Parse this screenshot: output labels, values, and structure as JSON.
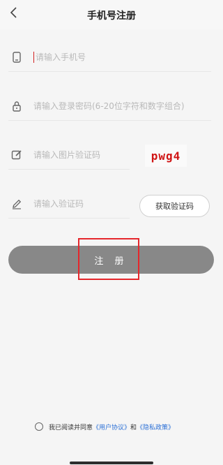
{
  "header": {
    "title": "手机号注册",
    "back_icon": "chevron-left-icon"
  },
  "form": {
    "phone": {
      "placeholder": "请输入手机号",
      "icon": "phone-icon",
      "value": ""
    },
    "password": {
      "placeholder": "请输入登录密码(6-20位字符和数字组合)",
      "icon": "lock-icon",
      "value": ""
    },
    "captcha": {
      "placeholder": "请输入图片验证码",
      "icon": "edit-icon",
      "value": "",
      "image_text": "pwg4"
    },
    "sms": {
      "placeholder": "请输入验证码",
      "icon": "pencil-icon",
      "value": "",
      "button_label": "获取验证码"
    }
  },
  "register_button": {
    "label": "注 册"
  },
  "agreement": {
    "prefix": "我已阅读并同意",
    "user_agreement": "《用户协议》",
    "and": "和",
    "privacy_policy": "《隐私政策》",
    "checked": false
  },
  "colors": {
    "accent_link": "#2a6fd6",
    "button_bg": "#888888",
    "captcha_text": "#d01515",
    "highlight": "#e5262b"
  }
}
